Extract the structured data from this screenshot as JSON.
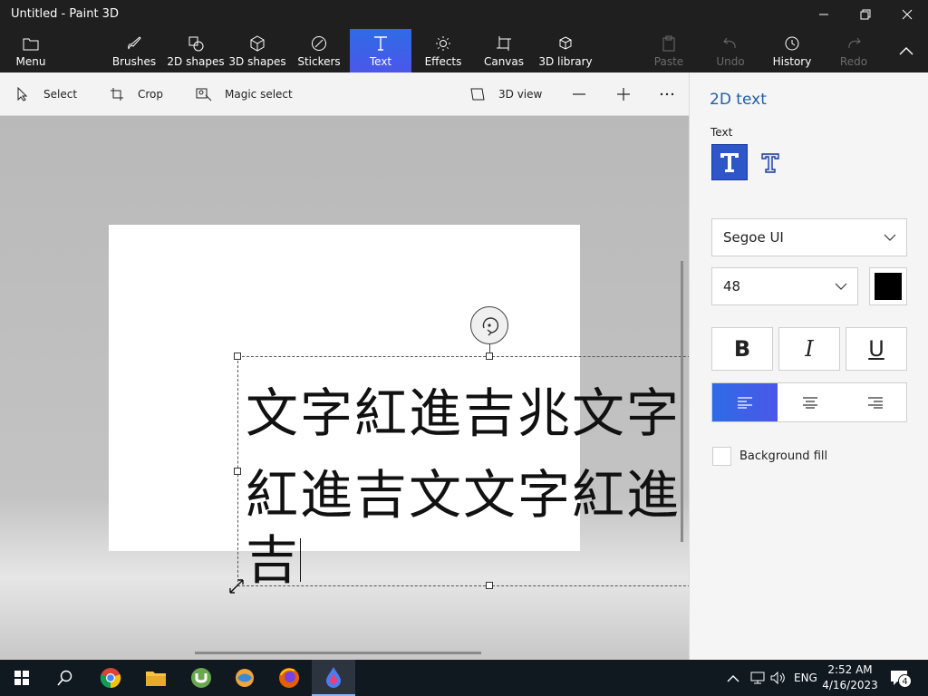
{
  "window": {
    "title": "Untitled - Paint 3D"
  },
  "ribbon": {
    "menu": "Menu",
    "tabs": [
      {
        "label": "Brushes"
      },
      {
        "label": "2D shapes"
      },
      {
        "label": "3D shapes"
      },
      {
        "label": "Stickers"
      },
      {
        "label": "Text",
        "active": true
      },
      {
        "label": "Effects"
      },
      {
        "label": "Canvas"
      },
      {
        "label": "3D library"
      }
    ],
    "actions": [
      {
        "label": "Paste",
        "enabled": false
      },
      {
        "label": "Undo",
        "enabled": false
      },
      {
        "label": "History",
        "enabled": true
      },
      {
        "label": "Redo",
        "enabled": false
      }
    ],
    "accent_color": "#4b57e8"
  },
  "toolbar": {
    "select": "Select",
    "crop": "Crop",
    "magic_select": "Magic select",
    "view_3d": "3D view"
  },
  "canvas": {
    "text_lines": [
      "文字紅進吉兆文字",
      "紅進吉文文字紅進",
      "吉"
    ]
  },
  "panel": {
    "title": "2D text",
    "text_label": "Text",
    "font": "Segoe UI",
    "size": "48",
    "text_color": "#000000",
    "bold": "B",
    "italic": "I",
    "underline": "U",
    "background_fill": "Background fill",
    "background_fill_checked": false,
    "alignment": "left"
  },
  "taskbar": {
    "language": "ENG",
    "time": "2:52 AM",
    "date": "4/16/2023",
    "notifications": "4"
  }
}
